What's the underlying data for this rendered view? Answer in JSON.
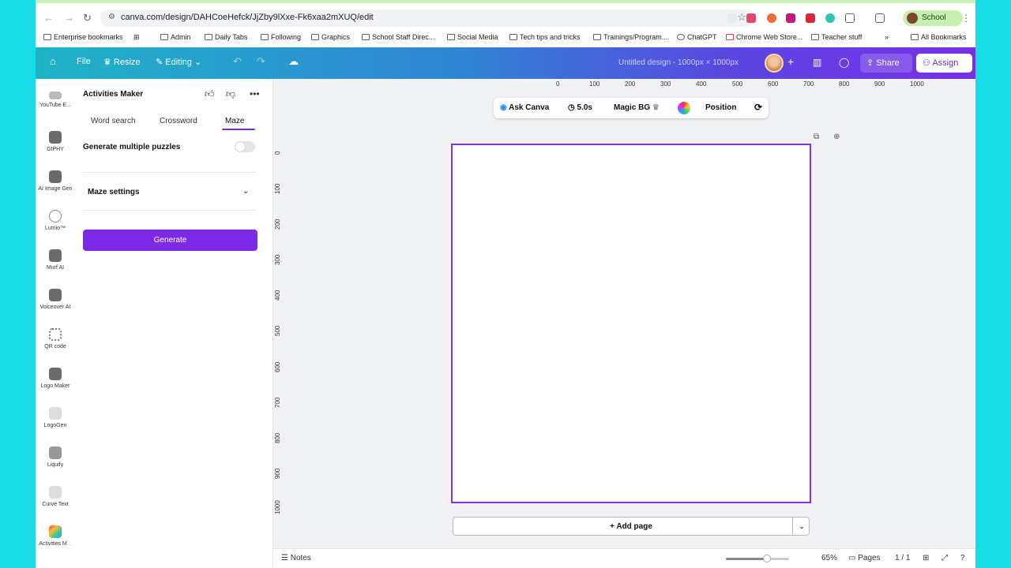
{
  "browser": {
    "url": "canva.com/design/DAHCoeHefck/JjZby9lXxe-Fk6xaa2mXUQ/edit",
    "profile": "School",
    "bookmarks": [
      "Enterprise bookmarks",
      "Admin",
      "Daily Tabs",
      "Following",
      "Graphics",
      "School Staff Direc...",
      "Social Media",
      "Tech tips and tricks",
      "Trainings/Program...",
      "ChatGPT",
      "Chrome Web Store...",
      "Teacher stuff",
      "All Bookmarks"
    ]
  },
  "toolbar": {
    "file": "File",
    "resize": "Resize",
    "editing": "Editing",
    "doc_title": "Untitled design - 1000px × 1000px",
    "share": "Share",
    "assign": "Assign"
  },
  "rail": [
    "YouTube E...",
    "GIPHY",
    "AI Image Gen",
    "Lumio™",
    "Murf AI",
    "Voiceover AI",
    "QR code",
    "Logo Maker",
    "LogoGen",
    "Liquify",
    "Curve Text",
    "Activities M..."
  ],
  "panel": {
    "title": "Activities Maker",
    "tabs": [
      "Word search",
      "Crossword",
      "Maze"
    ],
    "generate_multiple": "Generate multiple puzzles",
    "maze_settings": "Maze settings",
    "generate": "Generate"
  },
  "ctx": {
    "ask": "Ask Canva",
    "duration": "5.0s",
    "magic_bg": "Magic BG",
    "position": "Position"
  },
  "ruler_h": [
    "0",
    "100",
    "200",
    "300",
    "400",
    "500",
    "600",
    "700",
    "800",
    "900",
    "1000"
  ],
  "ruler_v": [
    "0",
    "100",
    "200",
    "300",
    "400",
    "500",
    "600",
    "700",
    "800",
    "900",
    "1000"
  ],
  "canvas": {
    "add_page": "+ Add page"
  },
  "status": {
    "notes": "Notes",
    "zoom": "65%",
    "zoom_fraction": 0.65,
    "pages": "Pages",
    "page_count": "1 / 1"
  },
  "colors": {
    "accent": "#7d2ae8",
    "background": "#19dde6"
  }
}
